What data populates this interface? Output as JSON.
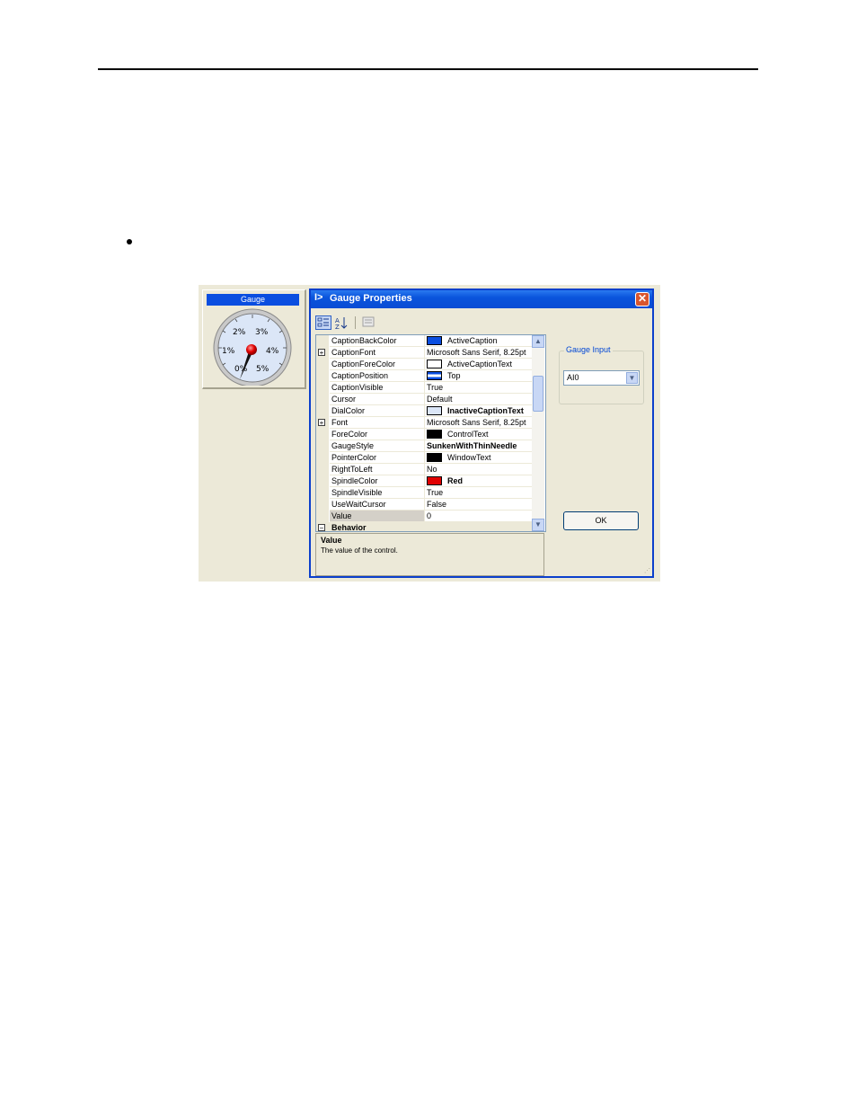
{
  "gauge": {
    "caption": "Gauge",
    "ticks": [
      "0%",
      "1%",
      "2%",
      "3%",
      "4%",
      "5%"
    ]
  },
  "dialog": {
    "title": "Gauge Properties",
    "close_label": "✕",
    "toolbar": {
      "categorized_icon": "categorized-icon",
      "alphabetical_icon": "alphabetical-icon",
      "property_pages_icon": "property-pages-icon"
    },
    "properties": [
      {
        "name": "CaptionBackColor",
        "value": "ActiveCaption",
        "swatch": "#0a4ee0"
      },
      {
        "name": "CaptionFont",
        "value": "Microsoft Sans Serif, 8.25pt",
        "expandable": true
      },
      {
        "name": "CaptionForeColor",
        "value": "ActiveCaptionText",
        "swatch": "#ffffff"
      },
      {
        "name": "CaptionPosition",
        "value": "Top",
        "swatch": "top"
      },
      {
        "name": "CaptionVisible",
        "value": "True"
      },
      {
        "name": "Cursor",
        "value": "Default"
      },
      {
        "name": "DialColor",
        "value": "InactiveCaptionText",
        "swatch": "#dbe6f7",
        "bold": true
      },
      {
        "name": "Font",
        "value": "Microsoft Sans Serif, 8.25pt",
        "expandable": true
      },
      {
        "name": "ForeColor",
        "value": "ControlText",
        "swatch": "#000000"
      },
      {
        "name": "GaugeStyle",
        "value": "SunkenWithThinNeedle",
        "bold": true
      },
      {
        "name": "PointerColor",
        "value": "WindowText",
        "swatch": "#000000"
      },
      {
        "name": "RightToLeft",
        "value": "No"
      },
      {
        "name": "SpindleColor",
        "value": "Red",
        "swatch": "#e00000",
        "bold": true
      },
      {
        "name": "SpindleVisible",
        "value": "True"
      },
      {
        "name": "UseWaitCursor",
        "value": "False"
      },
      {
        "name": "Value",
        "value": "0",
        "selected": true
      }
    ],
    "category_partial": "Behavior",
    "description": {
      "title": "Value",
      "text": "The value of the control."
    },
    "gauge_input": {
      "label": "Gauge Input",
      "selected": "AI0"
    },
    "ok_label": "OK"
  }
}
